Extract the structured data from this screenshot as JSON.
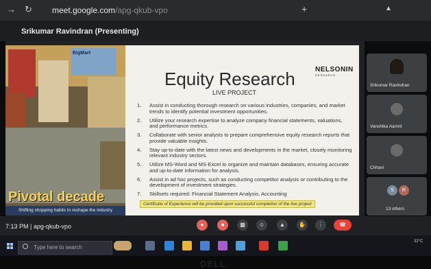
{
  "browser": {
    "url": "meet.google.com",
    "url_dim": "/apg-qkub-vpo"
  },
  "meeting": {
    "presenting_label": "Srikumar Ravindran (Presenting)",
    "time": "7:13 PM",
    "code": "apg-qkub-vpo",
    "separator": "|"
  },
  "slide": {
    "title": "Equity Research",
    "subtitle": "LIVE PROJECT",
    "logo": "NELSONIN",
    "logo_tag": "RESEARCH",
    "items": [
      {
        "num": "1.",
        "text": "Assist in conducting thorough research on various industries, companies, and market trends to identify potential investment opportunities."
      },
      {
        "num": "2.",
        "text": "Utilize your research expertise to analyze company financial statements, valuations, and performance metrics."
      },
      {
        "num": "3.",
        "text": "Collaborate with senior analysts to prepare comprehensive equity research reports that provide valuable insights."
      },
      {
        "num": "4.",
        "text": "Stay up-to-date with the latest news and developments in the market, closely monitoring relevant industry sectors."
      },
      {
        "num": "5.",
        "text": "Utilize MS-Word and MS-Excel to organize and maintain databases, ensuring accurate and up-to-date information for analysis."
      },
      {
        "num": "6.",
        "text": "Assist in ad hoc projects, such as conducting competitor analysis or contributing to the development of investment strategies."
      },
      {
        "num": "7.",
        "text": "Skillsets required: Financial Statement Analysis, Accounting"
      }
    ],
    "footnote": "Certificate of Experience will be provided upon successful completion of the live project"
  },
  "cover": {
    "store_label": "BigMart",
    "title": "Pivotal decade",
    "subtitle": "Shifting shopping habits to reshape the industry"
  },
  "participants": [
    {
      "name": "Srikumar Ravindran"
    },
    {
      "name": "Vanshika Aamrit"
    },
    {
      "name": "Chhavi"
    },
    {
      "name": "13 others",
      "initials": [
        "S",
        "R"
      ]
    }
  ],
  "taskbar": {
    "search_placeholder": "Type here to search",
    "weather": "32°C"
  },
  "bezel": {
    "brand": "DELL"
  },
  "colors": {
    "meet_dark": "#202124",
    "end_call": "#ea4335",
    "highlight": "#f3e880",
    "cover_title": "#f3d25a"
  }
}
